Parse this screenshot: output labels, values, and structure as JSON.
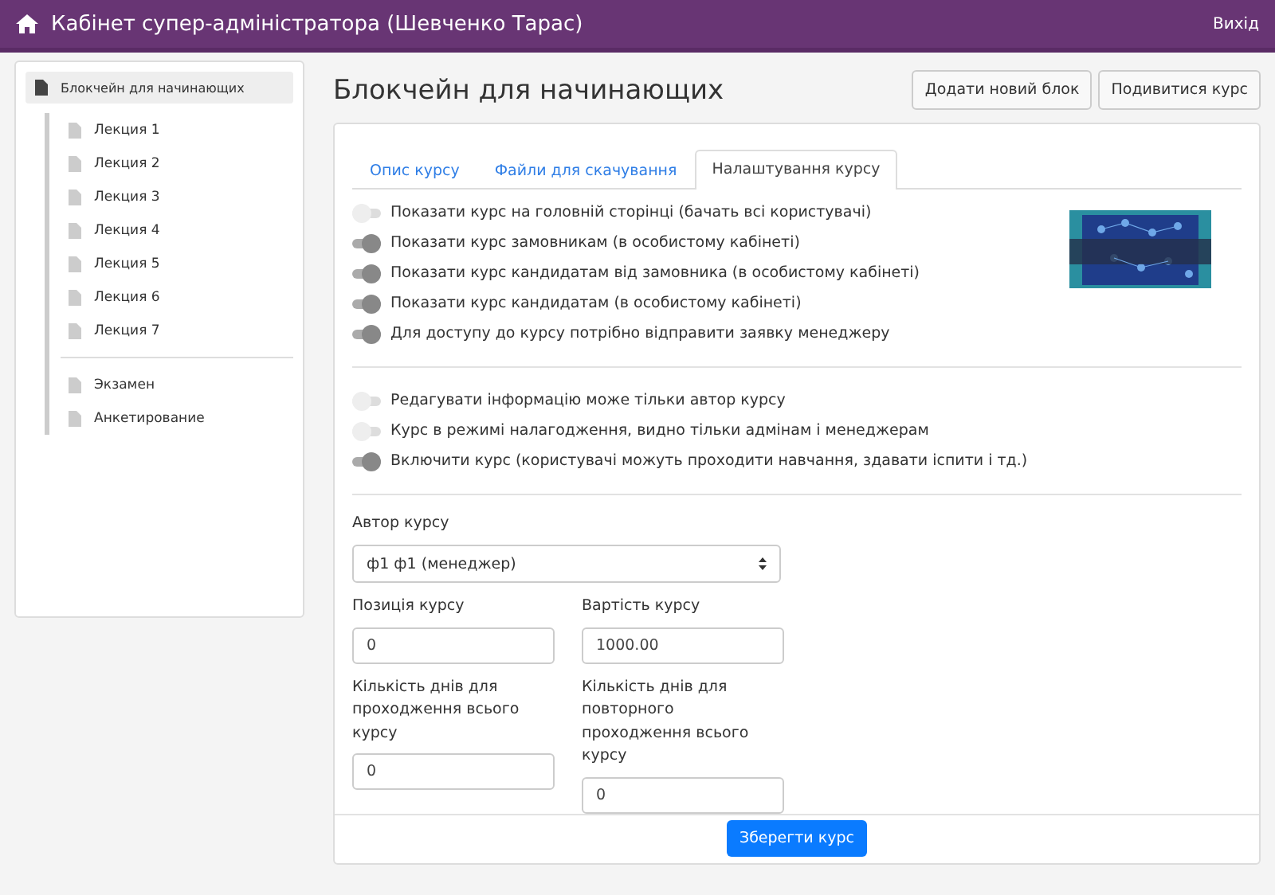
{
  "topbar": {
    "title": "Кабінет супер-адміністратора (Шевченко Тарас)",
    "logout": "Вихід"
  },
  "sidebar": {
    "course": {
      "label": "Блокчейн для начинающих",
      "selected": true
    },
    "lessons": [
      {
        "label": "Лекция 1"
      },
      {
        "label": "Лекция 2"
      },
      {
        "label": "Лекция 3"
      },
      {
        "label": "Лекция 4"
      },
      {
        "label": "Лекция 5"
      },
      {
        "label": "Лекция 6"
      },
      {
        "label": "Лекция 7"
      }
    ],
    "extras": [
      {
        "label": "Экзамен"
      },
      {
        "label": "Анкетирование"
      }
    ]
  },
  "page": {
    "title": "Блокчейн для начинающих",
    "buttons": [
      "Додати новий блок",
      "Подивитися курс"
    ]
  },
  "tabs": [
    {
      "label": "Опис курсу",
      "selected": false
    },
    {
      "label": "Файли для скачування",
      "selected": false
    },
    {
      "label": "Налаштування курсу",
      "selected": true
    }
  ],
  "course_image": {
    "kind": "picture"
  },
  "toggle_groups": [
    [
      {
        "label": "Показати курс на головній сторінці (бачать всі користувачі)",
        "on": false
      },
      {
        "label": "Показати курс замовникам (в особистому кабінеті)",
        "on": true
      },
      {
        "label": "Показати курс кандидатам від замовника (в особистому кабінеті)",
        "on": true
      },
      {
        "label": "Показати курс кандидатам (в особистому кабінеті)",
        "on": true
      },
      {
        "label": "Для доступу до курсу потрібно відправити заявку менеджеру",
        "on": true
      }
    ],
    [
      {
        "label": "Редагувати інформацію може тільки автор курсу",
        "on": false
      },
      {
        "label": "Курс в режимі налагодження, видно тільки адмінам і менеджерам",
        "on": false
      },
      {
        "label": "Включити курс (користувачі можуть проходити навчання, здавати іспити і тд.)",
        "on": true
      }
    ]
  ],
  "author": {
    "label": "Автор курсу",
    "value": "ф1 ф1 (менеджер)"
  },
  "fields": [
    {
      "label": "Позиція курсу",
      "value": "0"
    },
    {
      "label": "Вартість курсу",
      "value": "1000.00"
    },
    {
      "label": "Кількість днів для проходження всього курсу",
      "value": "0"
    },
    {
      "label": "Кількість днів для повторного проходження всього курсу",
      "value": "0"
    }
  ],
  "save_button": "Зберегти курс"
}
